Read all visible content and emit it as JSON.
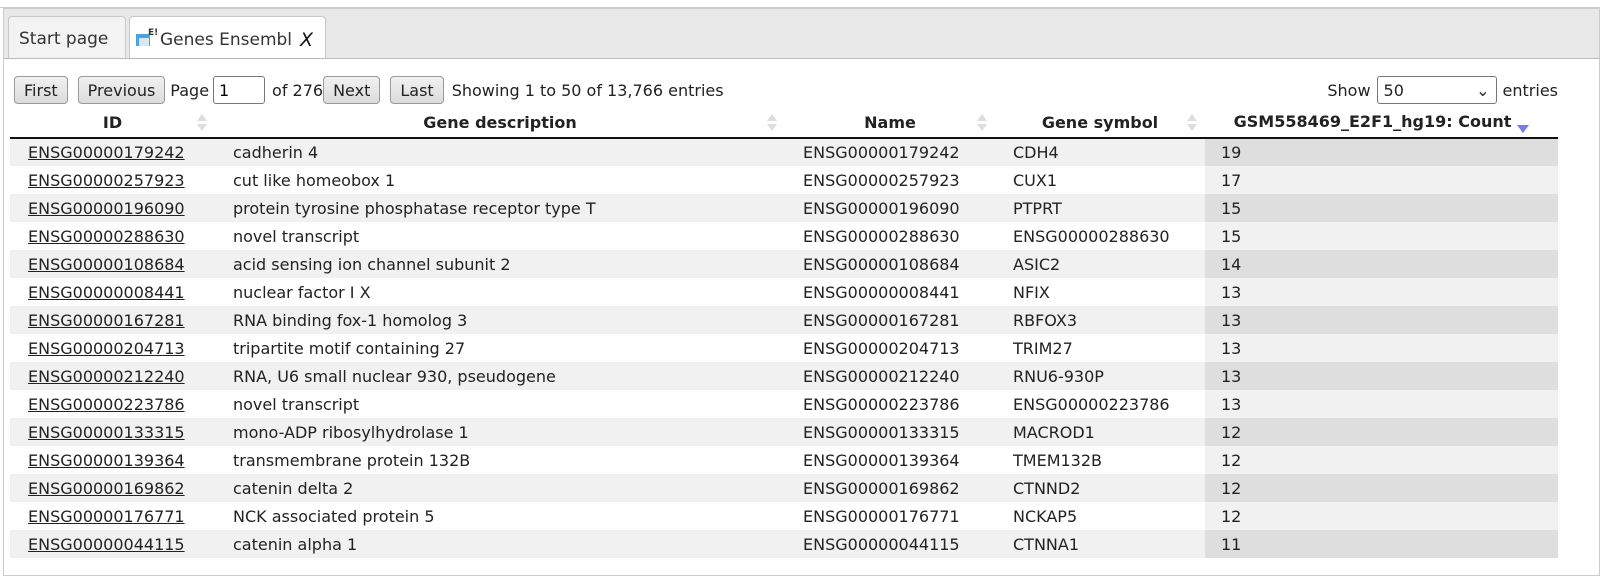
{
  "tabs": [
    {
      "label": "Start page"
    },
    {
      "label": "Genes Ensembl",
      "close": "X"
    }
  ],
  "pager": {
    "first": "First",
    "previous": "Previous",
    "page_label": "Page",
    "page_value": "1",
    "of_label": "of 276",
    "next": "Next",
    "last": "Last",
    "info": "Showing 1 to 50 of 13,766 entries",
    "show_label": "Show",
    "show_value": "50",
    "entries_label": "entries"
  },
  "columns": [
    "ID",
    "Gene description",
    "Name",
    "Gene symbol",
    "GSM558469_E2F1_hg19: Count"
  ],
  "rows": [
    [
      "ENSG00000179242",
      "cadherin 4",
      "ENSG00000179242",
      "CDH4",
      "19"
    ],
    [
      "ENSG00000257923",
      "cut like homeobox 1",
      "ENSG00000257923",
      "CUX1",
      "17"
    ],
    [
      "ENSG00000196090",
      "protein tyrosine phosphatase receptor type T",
      "ENSG00000196090",
      "PTPRT",
      "15"
    ],
    [
      "ENSG00000288630",
      "novel transcript",
      "ENSG00000288630",
      "ENSG00000288630",
      "15"
    ],
    [
      "ENSG00000108684",
      "acid sensing ion channel subunit 2",
      "ENSG00000108684",
      "ASIC2",
      "14"
    ],
    [
      "ENSG00000008441",
      "nuclear factor I X",
      "ENSG00000008441",
      "NFIX",
      "13"
    ],
    [
      "ENSG00000167281",
      "RNA binding fox-1 homolog 3",
      "ENSG00000167281",
      "RBFOX3",
      "13"
    ],
    [
      "ENSG00000204713",
      "tripartite motif containing 27",
      "ENSG00000204713",
      "TRIM27",
      "13"
    ],
    [
      "ENSG00000212240",
      "RNA, U6 small nuclear 930, pseudogene",
      "ENSG00000212240",
      "RNU6-930P",
      "13"
    ],
    [
      "ENSG00000223786",
      "novel transcript",
      "ENSG00000223786",
      "ENSG00000223786",
      "13"
    ],
    [
      "ENSG00000133315",
      "mono-ADP ribosylhydrolase 1",
      "ENSG00000133315",
      "MACROD1",
      "12"
    ],
    [
      "ENSG00000139364",
      "transmembrane protein 132B",
      "ENSG00000139364",
      "TMEM132B",
      "12"
    ],
    [
      "ENSG00000169862",
      "catenin delta 2",
      "ENSG00000169862",
      "CTNND2",
      "12"
    ],
    [
      "ENSG00000176771",
      "NCK associated protein 5",
      "ENSG00000176771",
      "NCKAP5",
      "12"
    ],
    [
      "ENSG00000044115",
      "catenin alpha 1",
      "ENSG00000044115",
      "CTNNA1",
      "11"
    ]
  ]
}
